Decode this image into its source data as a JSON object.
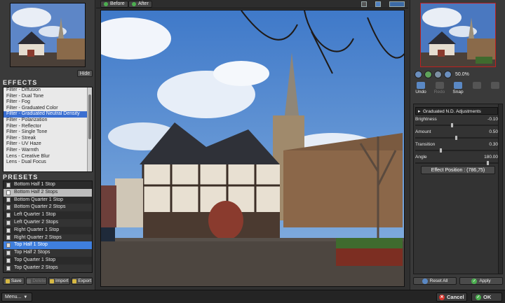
{
  "top_toggles": {
    "before": "Before",
    "after": "After"
  },
  "left": {
    "hide_label": "Hide",
    "effects_title": "EFFECTS",
    "effects": [
      "Filter - Diffusion",
      "Filter - Dual Tone",
      "Filter - Fog",
      "Filter - Graduated Color",
      "Filter - Graduated Neutral Density",
      "Filter - Polarization",
      "Filter - Reflector",
      "Filter - Single Tone",
      "Filter - Streak",
      "Filter - UV Haze",
      "Filter - Warmth",
      "Lens - Creative Blur",
      "Lens - Dual Focus"
    ],
    "effects_selected": "Filter - Graduated Neutral Density",
    "presets_title": "PRESETS",
    "presets": [
      "Bottom Half 1 Stop",
      "Bottom Half 2 Stops",
      "Bottom Quarter 1 Stop",
      "Bottom Quarter 2 Stops",
      "Left Quarter 1 Stop",
      "Left Quarter 2 Stops",
      "Right Quarter 1 Stop",
      "Right Quarter 2 Stops",
      "Top Half 1 Stop",
      "Top Half 2 Stops",
      "Top Quarter 1 Stop",
      "Top Quarter 2 Stops"
    ],
    "presets_selected": "Top Half 1 Stop",
    "preset_buttons": {
      "save": "Save",
      "delete": "Delete",
      "import": "Import",
      "export": "Export"
    }
  },
  "right": {
    "zoom": "50.0%",
    "tools": {
      "undo": "Undo",
      "redo": "Redo",
      "snap": "Snap",
      "compare": "",
      "options": ""
    },
    "adjust_header": "Graduated N.D. Adjustments",
    "sliders": [
      {
        "label": "Brightness",
        "value": "-0.10",
        "level": 0.45
      },
      {
        "label": "Amount",
        "value": "0.50",
        "level": 0.5
      },
      {
        "label": "Transition",
        "value": "0.30",
        "level": 0.3
      },
      {
        "label": "Angle",
        "value": "180.00",
        "level": 0.9
      }
    ],
    "effect_position": "Effect Position : (786,75)",
    "reset_all": "Reset All",
    "apply": "Apply"
  },
  "bottom": {
    "menu": "Menu...",
    "cancel": "Cancel",
    "ok": "OK"
  },
  "colors": {
    "selection_blue": "#3b6fd1",
    "preset_selection": "#3f7fde",
    "highlight_red": "#c0201f"
  }
}
